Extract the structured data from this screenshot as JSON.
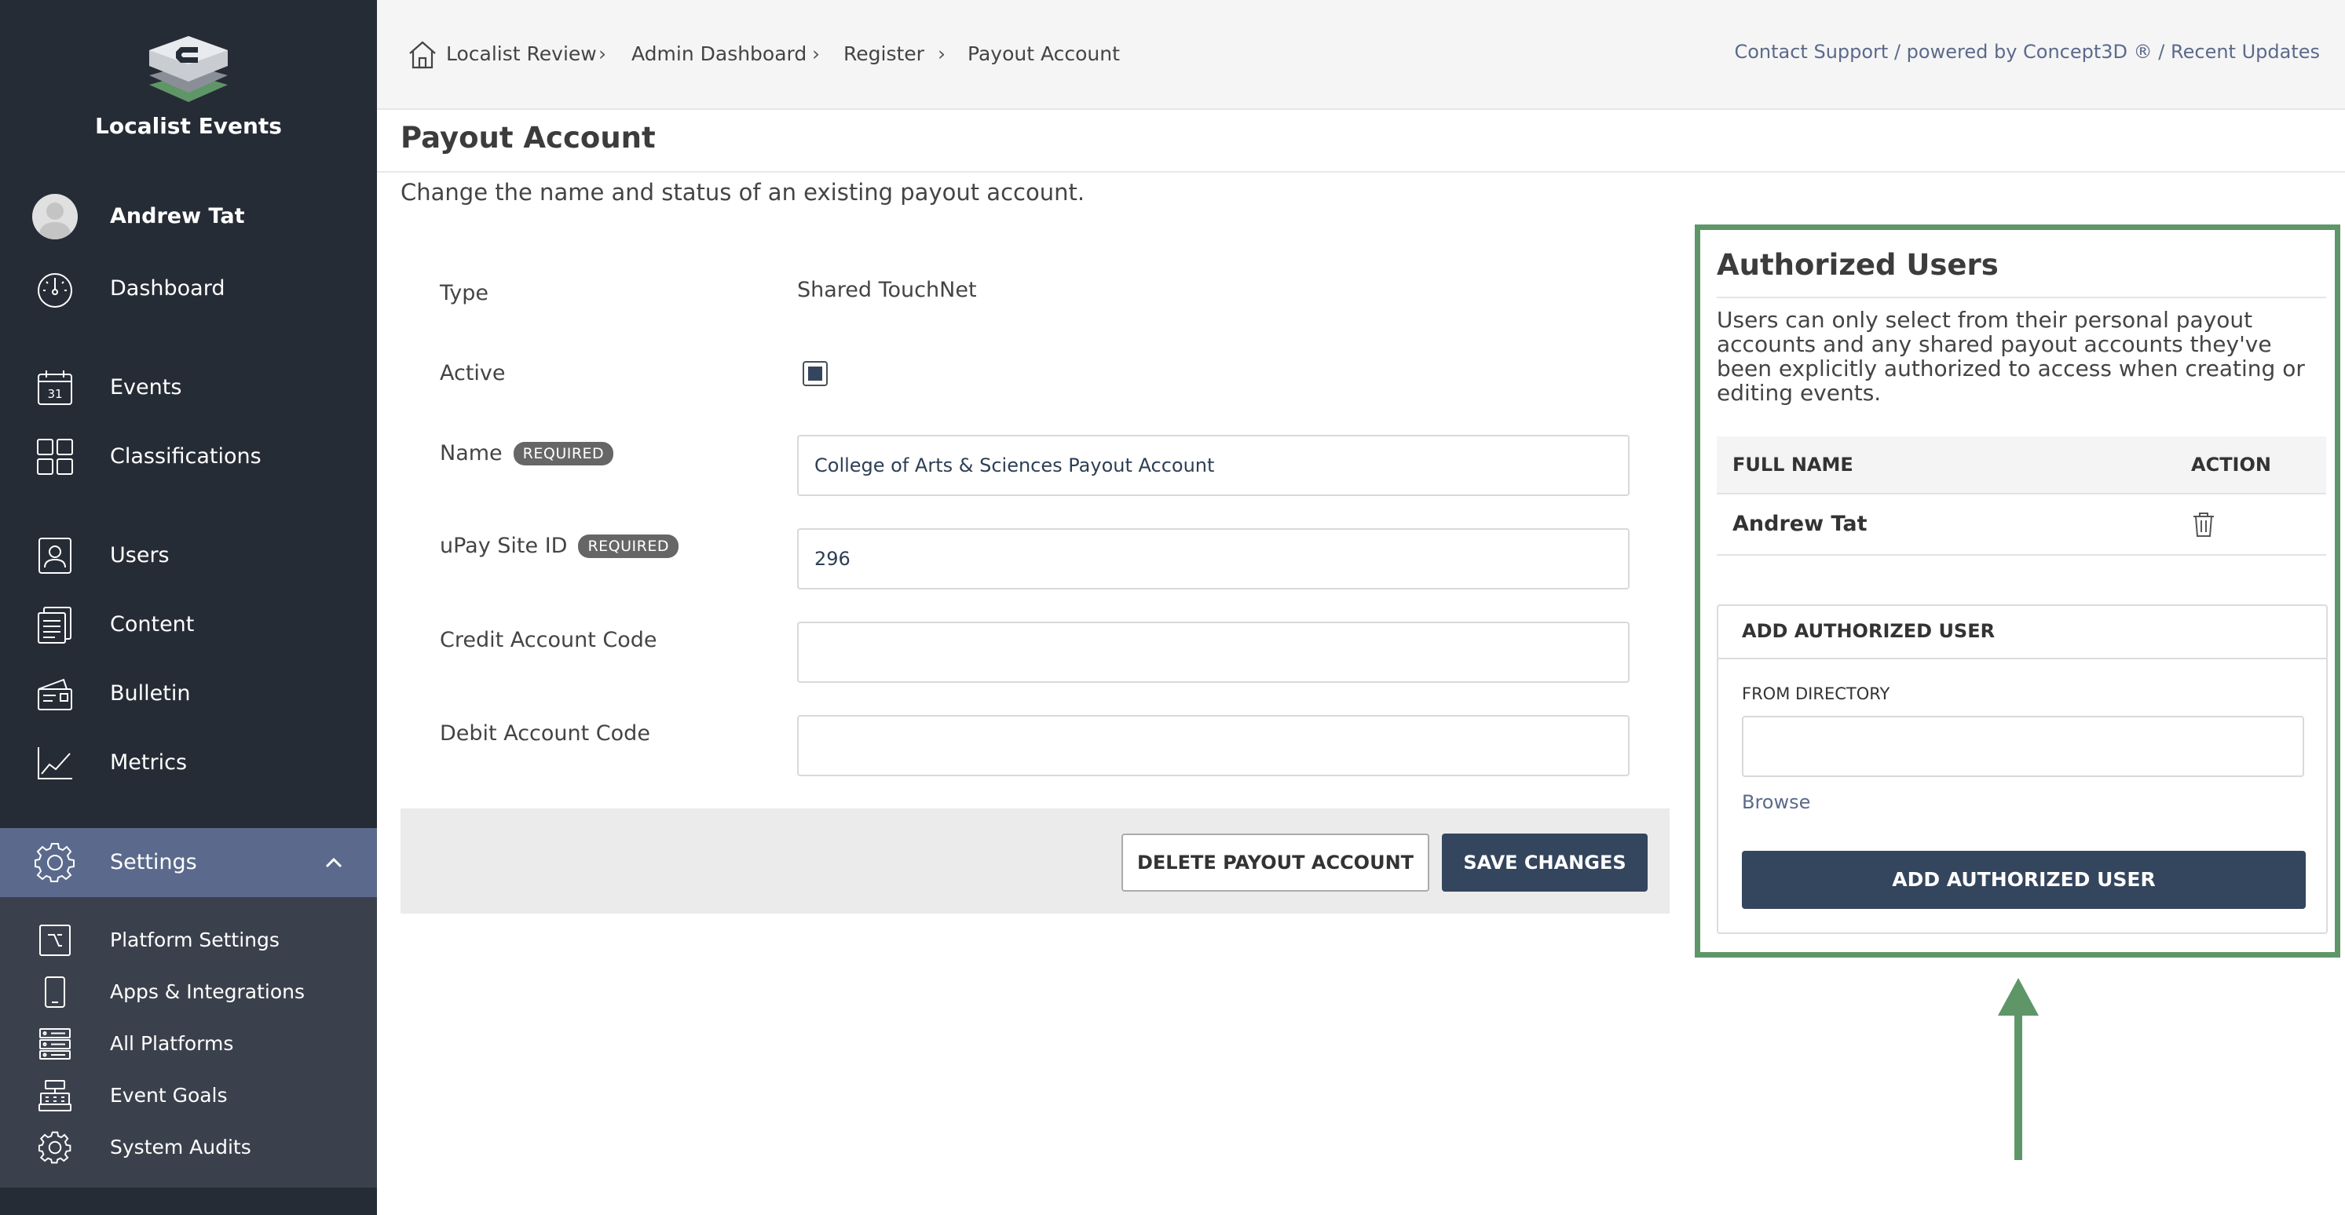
{
  "app": {
    "name": "Localist Events"
  },
  "user": {
    "name": "Andrew Tat"
  },
  "nav": {
    "dashboard": "Dashboard",
    "events": "Events",
    "events_icon_day": "31",
    "classifications": "Classifications",
    "users": "Users",
    "content": "Content",
    "bulletin": "Bulletin",
    "metrics": "Metrics",
    "settings": "Settings"
  },
  "settings_sub": {
    "platform_settings": "Platform Settings",
    "apps_integrations": "Apps & Integrations",
    "all_platforms": "All Platforms",
    "event_goals": "Event Goals",
    "system_audits": "System Audits"
  },
  "breadcrumb": [
    "Localist Review",
    "Admin Dashboard",
    "Register",
    "Payout Account"
  ],
  "breadcrumb_sep": "›",
  "top_links": "Contact Support / powered by Concept3D ® / Recent Updates",
  "page": {
    "title": "Payout Account",
    "description": "Change the name and status of an existing payout account."
  },
  "form": {
    "type_label": "Type",
    "type_value": "Shared TouchNet",
    "active_label": "Active",
    "active_checked": true,
    "name_label": "Name",
    "name_value": "College of Arts & Sciences Payout Account",
    "required_badge": "REQUIRED",
    "upay_label": "uPay Site ID",
    "upay_value": "296",
    "credit_label": "Credit Account Code",
    "credit_value": "",
    "debit_label": "Debit Account Code",
    "debit_value": "",
    "delete_button": "DELETE PAYOUT ACCOUNT",
    "save_button": "SAVE CHANGES"
  },
  "authorized_users": {
    "title": "Authorized Users",
    "description": "Users can only select from their personal payout accounts and any shared payout accounts they've been explicitly authorized to access when creating or editing events.",
    "col_name": "FULL NAME",
    "col_action": "ACTION",
    "rows": [
      {
        "name": "Andrew Tat"
      }
    ],
    "add_title": "ADD AUTHORIZED USER",
    "directory_label": "FROM DIRECTORY",
    "directory_value": "",
    "browse": "Browse",
    "add_button": "ADD AUTHORIZED USER"
  },
  "colors": {
    "sidebar_bg": "#262c36",
    "sidebar_active": "#5b6a8c",
    "sidebar_sub_bg": "#3b414c",
    "primary_button": "#34455e",
    "highlight": "#5f9668",
    "link": "#5b6a8c"
  }
}
